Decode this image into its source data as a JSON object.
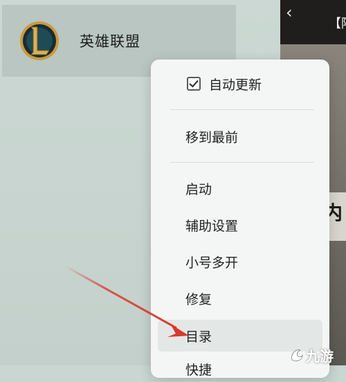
{
  "game": {
    "name": "英雄联盟",
    "logo_letter": "L"
  },
  "right_panel": {
    "back_glyph": "‹",
    "news_title": "【阿",
    "content_glyph": "内"
  },
  "context_menu": {
    "items": [
      {
        "label": "自动更新",
        "type": "checkbox",
        "checked": true
      },
      {
        "label": "移到最前",
        "type": "item"
      },
      {
        "label": "启动",
        "type": "item"
      },
      {
        "label": "辅助设置",
        "type": "item"
      },
      {
        "label": "小号多开",
        "type": "item"
      },
      {
        "label": "修复",
        "type": "item"
      },
      {
        "label": "目录",
        "type": "item",
        "highlighted": true
      },
      {
        "label": "快捷",
        "type": "item",
        "partial": true
      }
    ]
  },
  "watermark": {
    "text": "九游"
  },
  "colors": {
    "arrow": "#d9382b",
    "menu_bg": "#f4f6f5",
    "tile_bg": "#b9c6c1"
  }
}
